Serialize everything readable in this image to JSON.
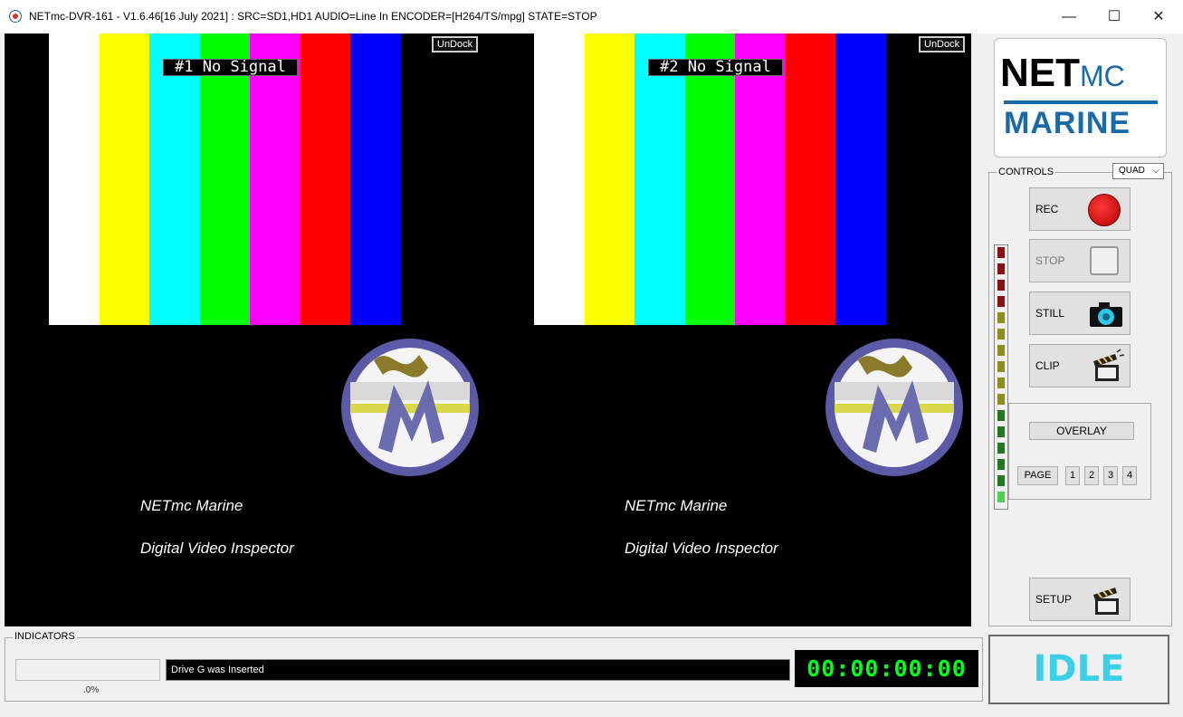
{
  "window": {
    "title": "NETmc-DVR-161 -  V1.6.46[16 July 2021] : SRC=SD1,HD1 AUDIO=Line In  ENCODER=[H264/TS/mpg] STATE=STOP",
    "minimize_glyph": "—",
    "maximize_glyph": "☐",
    "close_glyph": "✕"
  },
  "colors": {
    "bars": [
      "#ffffff",
      "#ffff00",
      "#00ffff",
      "#00ff00",
      "#ff00ff",
      "#ff0000",
      "#0000ff"
    ],
    "timecode": "#00ff20",
    "idle": "#3ad0e8",
    "logo_blue": "#1a6aa8"
  },
  "channels": [
    {
      "no_signal": "#1 No Signal",
      "undock": "UnDock",
      "caption1": "NETmc Marine",
      "caption2": "Digital Video Inspector"
    },
    {
      "no_signal": "#2 No Signal",
      "undock": "UnDock",
      "caption1": "NETmc Marine",
      "caption2": "Digital Video Inspector"
    }
  ],
  "logo": {
    "net": "NET",
    "mc": "MC",
    "marine": "MARINE"
  },
  "controls": {
    "label": "CONTROLS",
    "view_mode": "QUAD",
    "rec": "REC",
    "stop": "STOP",
    "still": "STILL",
    "clip": "CLIP",
    "setup": "SETUP"
  },
  "overlay": {
    "button": "OVERLAY",
    "page_label": "PAGE",
    "pages": [
      "1",
      "2",
      "3",
      "4"
    ]
  },
  "meter_colors": [
    "#8b0f0f",
    "#8b0f0f",
    "#8b0f0f",
    "#8b0f0f",
    "#8e8e1a",
    "#8e8e1a",
    "#8e8e1a",
    "#8e8e1a",
    "#8e8e1a",
    "#8e8e1a",
    "#1f7a1f",
    "#1f7a1f",
    "#1f7a1f",
    "#1f7a1f",
    "#1f7a1f",
    "#4fd04f"
  ],
  "indicators": {
    "label": "INDICATORS",
    "progress_percent": 0,
    "progress_text": ".0%",
    "status": "Drive G was Inserted",
    "timecode": "00:00:00:00",
    "state": "IDLE"
  }
}
